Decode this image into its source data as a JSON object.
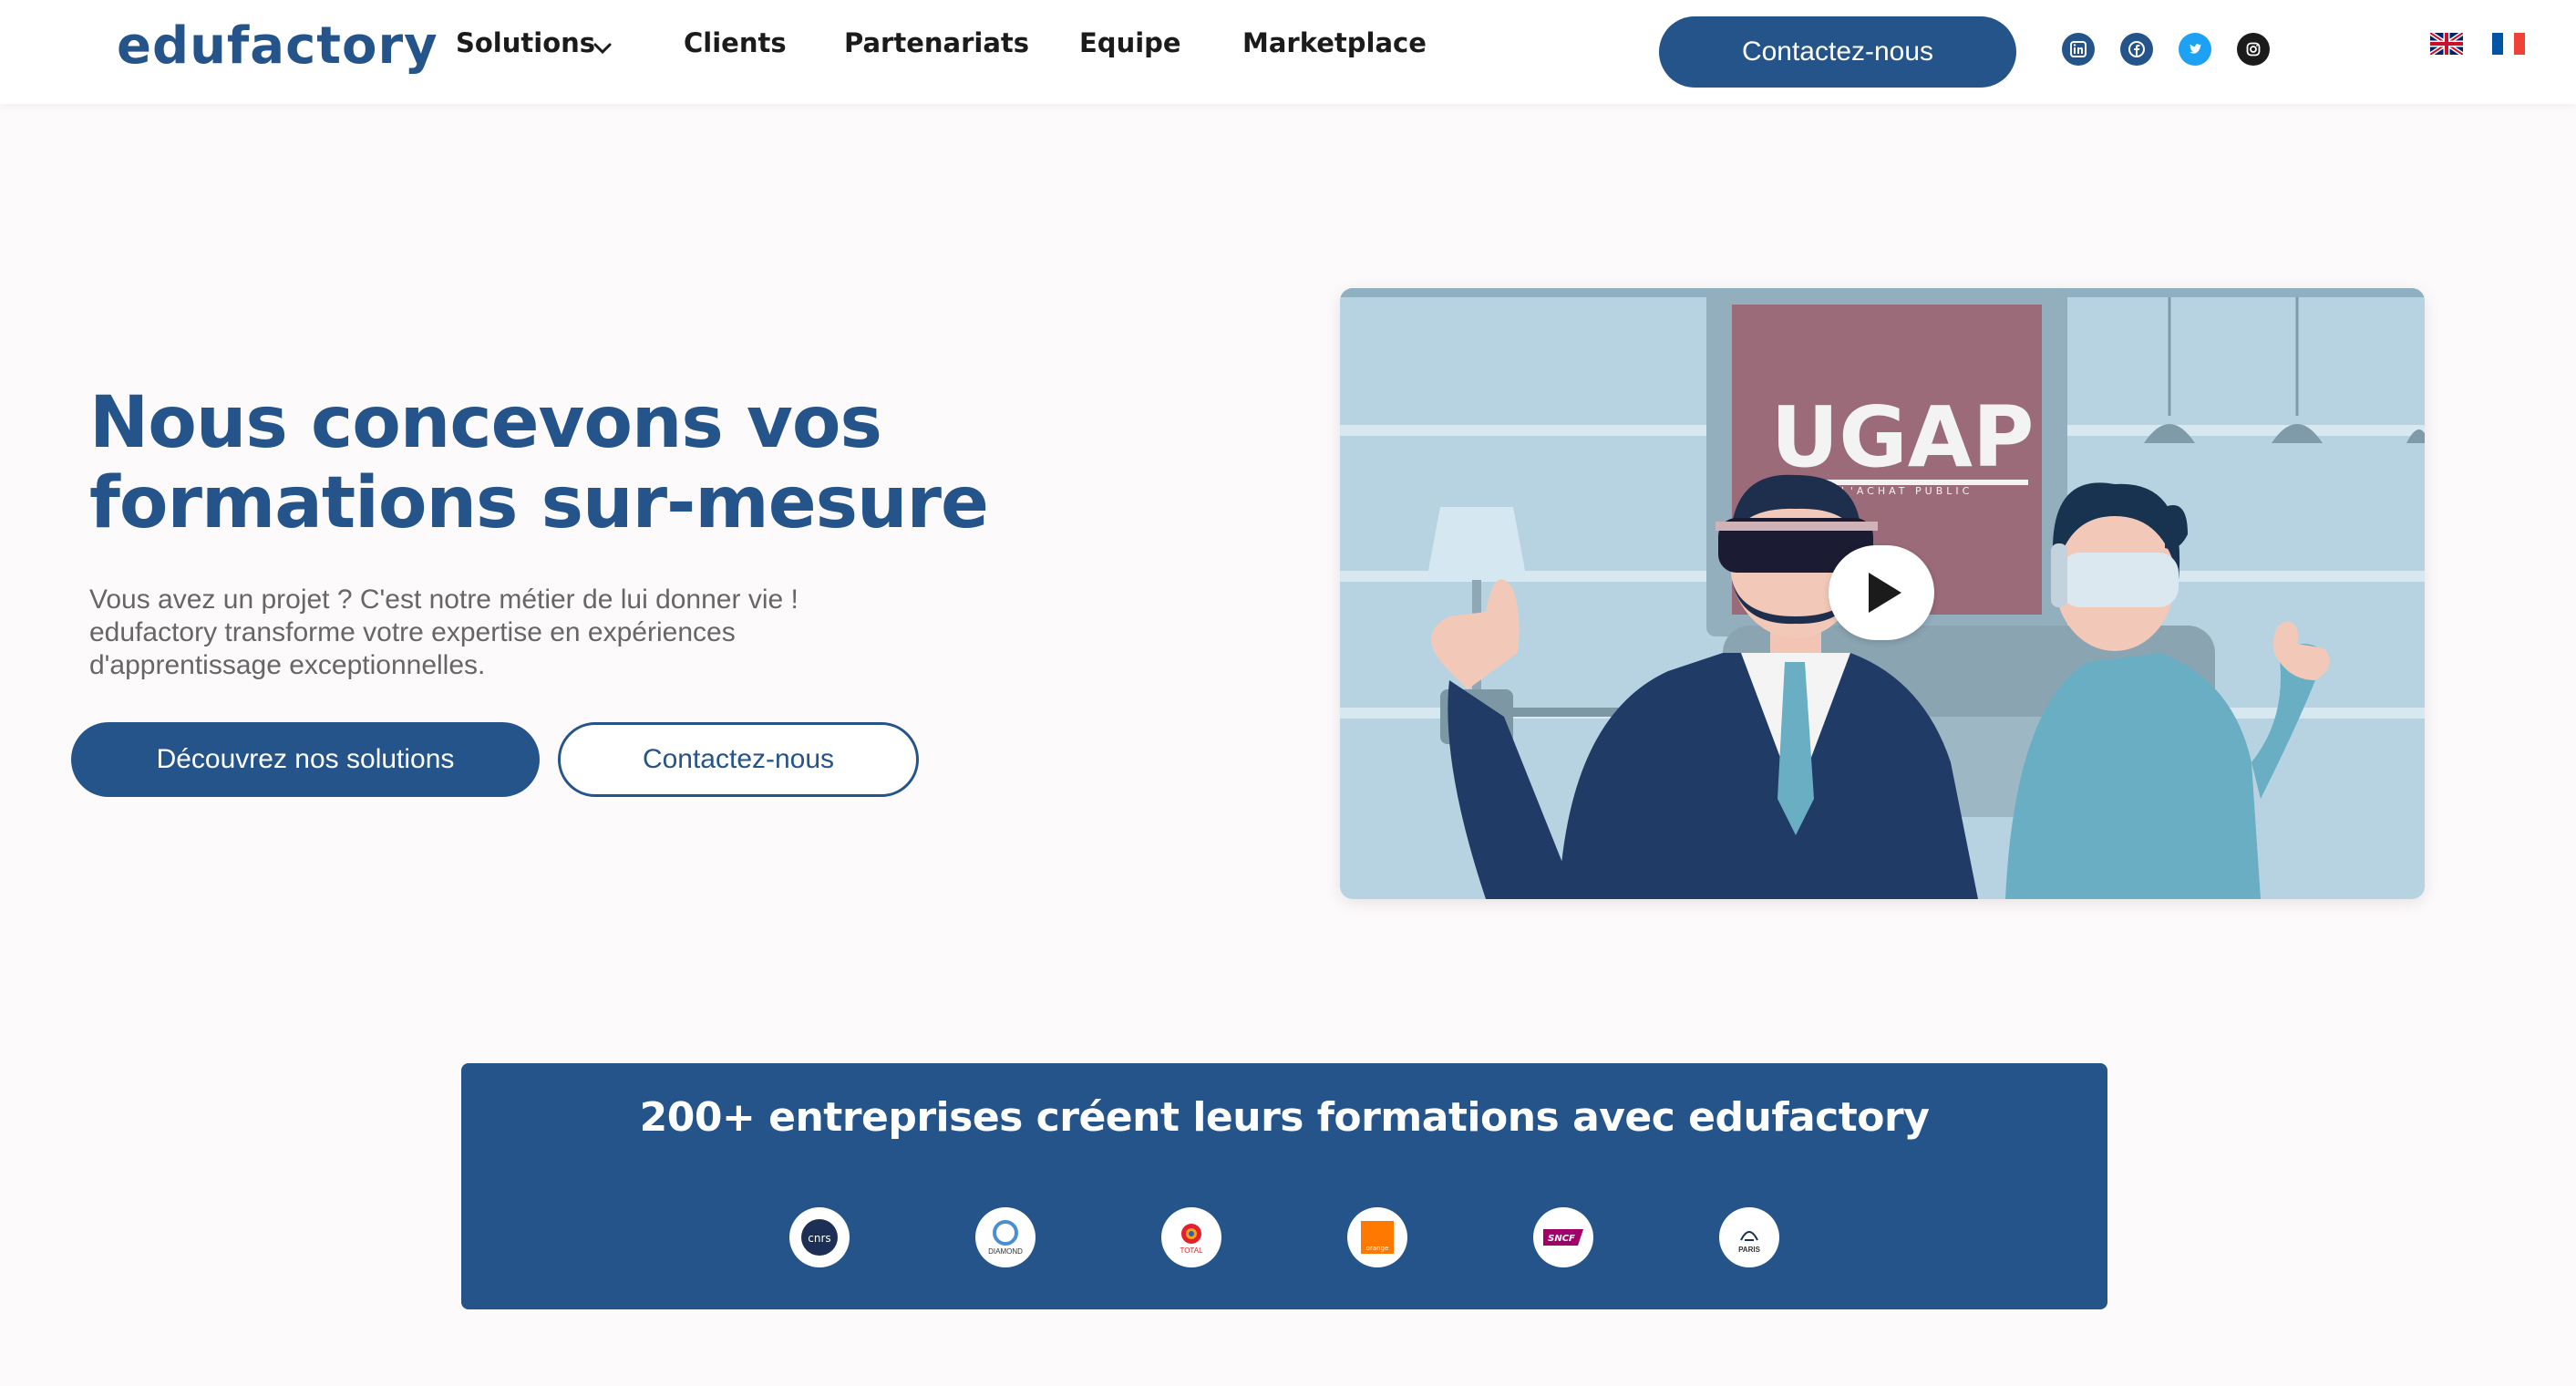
{
  "header": {
    "logo": "edufactory",
    "nav": {
      "solutions": "Solutions",
      "clients": "Clients",
      "partenariats": "Partenariats",
      "equipe": "Equipe",
      "marketplace": "Marketplace"
    },
    "contact_label": "Contactez-nous",
    "socials": [
      "linkedin-icon",
      "facebook-icon",
      "twitter-icon",
      "instagram-icon"
    ],
    "languages": [
      "english-flag-icon",
      "french-flag-icon"
    ]
  },
  "hero": {
    "title": "Nous concevons vos formations sur-mesure",
    "subtitle_lines": [
      "Vous avez un projet ? C'est notre métier de lui donner vie !",
      "edufactory transforme votre expertise en expériences",
      "d'apprentissage exceptionnelles."
    ],
    "primary_button": "Découvrez nos solutions",
    "secondary_button": "Contactez-nous"
  },
  "video": {
    "logo_text": "UGAP",
    "logo_tagline": "L'ACHAT PUBLIC"
  },
  "clients": {
    "title": "200+ entreprises créent leurs formations avec edufactory",
    "logos": [
      {
        "name": "cnrs",
        "label": "cnrs"
      },
      {
        "name": "dassault",
        "label": "DIAMOND"
      },
      {
        "name": "total",
        "label": "TOTAL"
      },
      {
        "name": "orange",
        "label": "orange"
      },
      {
        "name": "sncf",
        "label": "SNCF"
      },
      {
        "name": "paris",
        "label": "PARIS"
      }
    ]
  },
  "colors": {
    "brand": "#24548a",
    "background": "#fdfafb",
    "text_muted": "#666666"
  }
}
